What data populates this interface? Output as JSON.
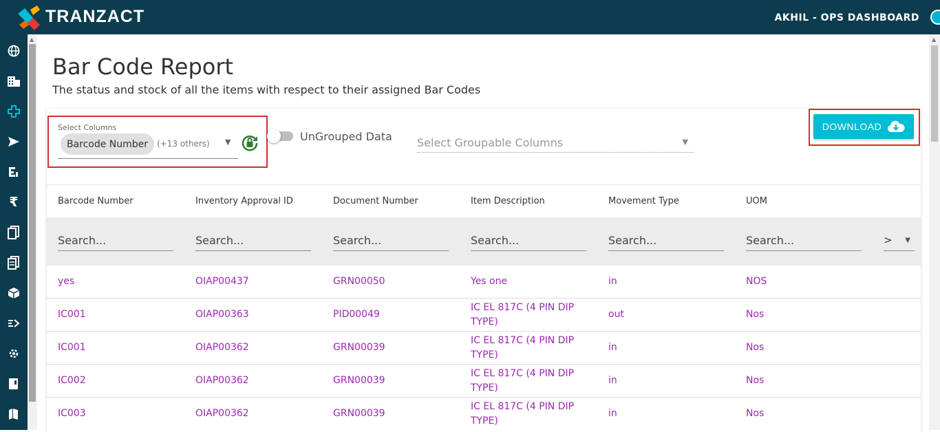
{
  "app": {
    "brand": "TRANZACT",
    "user": "AKHIL - OPS DASHBOARD"
  },
  "sidebar": {
    "items": [
      "globe-icon",
      "building-icon",
      "plus-icon",
      "send-icon",
      "list-icon",
      "rupee-icon",
      "copy-icon",
      "document-icon",
      "package-icon",
      "flow-icon",
      "settings-icon",
      "book-icon",
      "map-icon"
    ]
  },
  "page": {
    "title": "Bar Code Report",
    "subtitle": "The status and stock of all the items with respect to their assigned Bar Codes"
  },
  "controls": {
    "select_columns_label": "Select Columns",
    "selected_chip": "Barcode Number",
    "others": "(+13 others)",
    "toggle_label": "UnGrouped Data",
    "group_placeholder": "Select Groupable Columns",
    "download_label": "DOWNLOAD"
  },
  "colors": {
    "accent": "#00bcd4",
    "header": "#0c3c4e",
    "link": "#9c27b0",
    "highlight": "#d32f2f",
    "lock": "#2e7d32"
  },
  "table": {
    "headers": [
      "Barcode Number",
      "Inventory Approval ID",
      "Document Number",
      "Item Description",
      "Movement Type",
      "UOM"
    ],
    "search_placeholder": "Search...",
    "more_label": ">",
    "rows": [
      [
        "yes",
        "OIAP00437",
        "GRN00050",
        "Yes one",
        "in",
        "NOS"
      ],
      [
        "IC001",
        "OIAP00363",
        "PID00049",
        "IC EL 817C (4 PIN DIP TYPE)",
        "out",
        "Nos"
      ],
      [
        "IC001",
        "OIAP00362",
        "GRN00039",
        "IC EL 817C (4 PIN DIP TYPE)",
        "in",
        "Nos"
      ],
      [
        "IC002",
        "OIAP00362",
        "GRN00039",
        "IC EL 817C (4 PIN DIP TYPE)",
        "in",
        "Nos"
      ],
      [
        "IC003",
        "OIAP00362",
        "GRN00039",
        "IC EL 817C (4 PIN DIP TYPE)",
        "in",
        "Nos"
      ]
    ]
  }
}
